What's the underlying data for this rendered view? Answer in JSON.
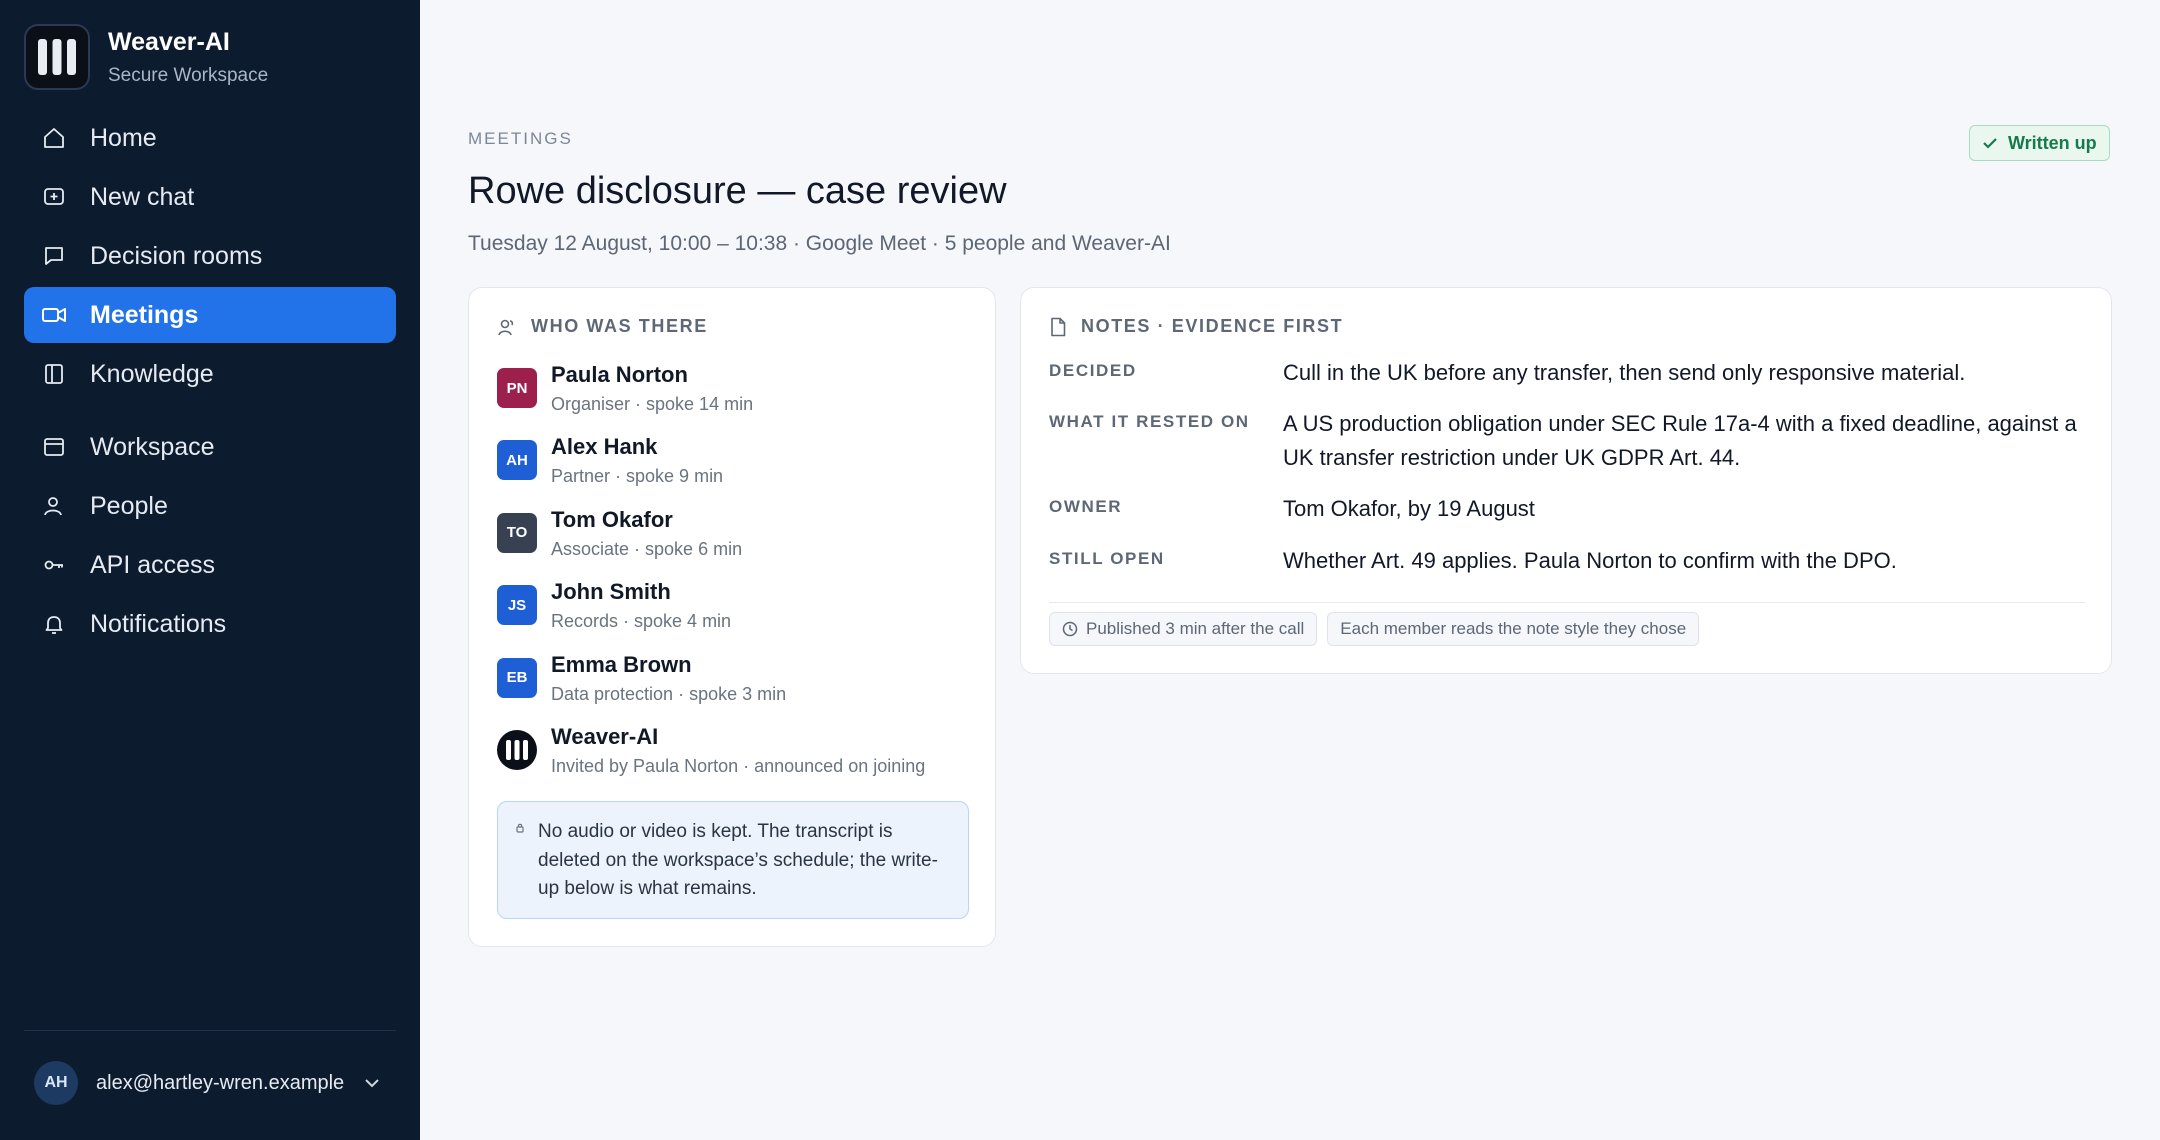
{
  "app": {
    "name": "Weaver-AI",
    "subtitle": "Secure Workspace"
  },
  "nav": {
    "primary": [
      {
        "label": "Home",
        "icon": "home-icon"
      },
      {
        "label": "New chat",
        "icon": "plus-square-icon"
      },
      {
        "label": "Decision rooms",
        "icon": "chat-bubble-icon"
      },
      {
        "label": "Meetings",
        "icon": "video-camera-icon",
        "active": true
      },
      {
        "label": "Knowledge",
        "icon": "book-icon"
      }
    ],
    "secondary": [
      {
        "label": "Workspace",
        "icon": "window-icon"
      },
      {
        "label": "People",
        "icon": "user-icon"
      },
      {
        "label": "API access",
        "icon": "key-icon"
      },
      {
        "label": "Notifications",
        "icon": "bell-icon"
      }
    ]
  },
  "user": {
    "initials": "AH",
    "email": "alex@hartley-wren.example"
  },
  "page": {
    "eyebrow": "MEETINGS",
    "title": "Rowe disclosure — case review",
    "meta": "Tuesday 12 August, 10:00 – 10:38 · Google Meet · 5 people and Weaver-AI",
    "badge": "Written up"
  },
  "attendees": {
    "heading": "WHO WAS THERE",
    "people": [
      {
        "initials": "PN",
        "name": "Paula Norton",
        "role": "Organiser · spoke 14 min",
        "color": "#9c1f4c"
      },
      {
        "initials": "AH",
        "name": "Alex Hank",
        "role": "Partner · spoke 9 min",
        "color": "#1f5fd6"
      },
      {
        "initials": "TO",
        "name": "Tom Okafor",
        "role": "Associate · spoke 6 min",
        "color": "#374151"
      },
      {
        "initials": "JS",
        "name": "John Smith",
        "role": "Records · spoke 4 min",
        "color": "#1f5fd6"
      },
      {
        "initials": "EB",
        "name": "Emma Brown",
        "role": "Data protection · spoke 3 min",
        "color": "#1f5fd6"
      },
      {
        "initials": "",
        "name": "Weaver-AI",
        "role": "Invited by Paula Norton · announced on joining",
        "color": "#0a0f18"
      }
    ],
    "notice": "No audio or video is kept. The transcript is deleted on the workspace’s schedule; the write-up below is what remains."
  },
  "notes": {
    "heading": "NOTES · EVIDENCE FIRST",
    "rows": [
      {
        "label": "DECIDED",
        "value": "Cull in the UK before any transfer, then send only responsive material."
      },
      {
        "label": "WHAT IT RESTED ON",
        "value": "A US production obligation under SEC Rule 17a-4 with a fixed deadline, against a UK transfer restriction under UK GDPR Art. 44."
      },
      {
        "label": "OWNER",
        "value": "Tom Okafor, by 19 August"
      },
      {
        "label": "STILL OPEN",
        "value": "Whether Art. 49 applies. Paula Norton to confirm with the DPO."
      }
    ],
    "chips": [
      {
        "label": "Published 3 min after the call",
        "icon": "clock-icon"
      },
      {
        "label": "Each member reads the note style they chose"
      }
    ]
  }
}
